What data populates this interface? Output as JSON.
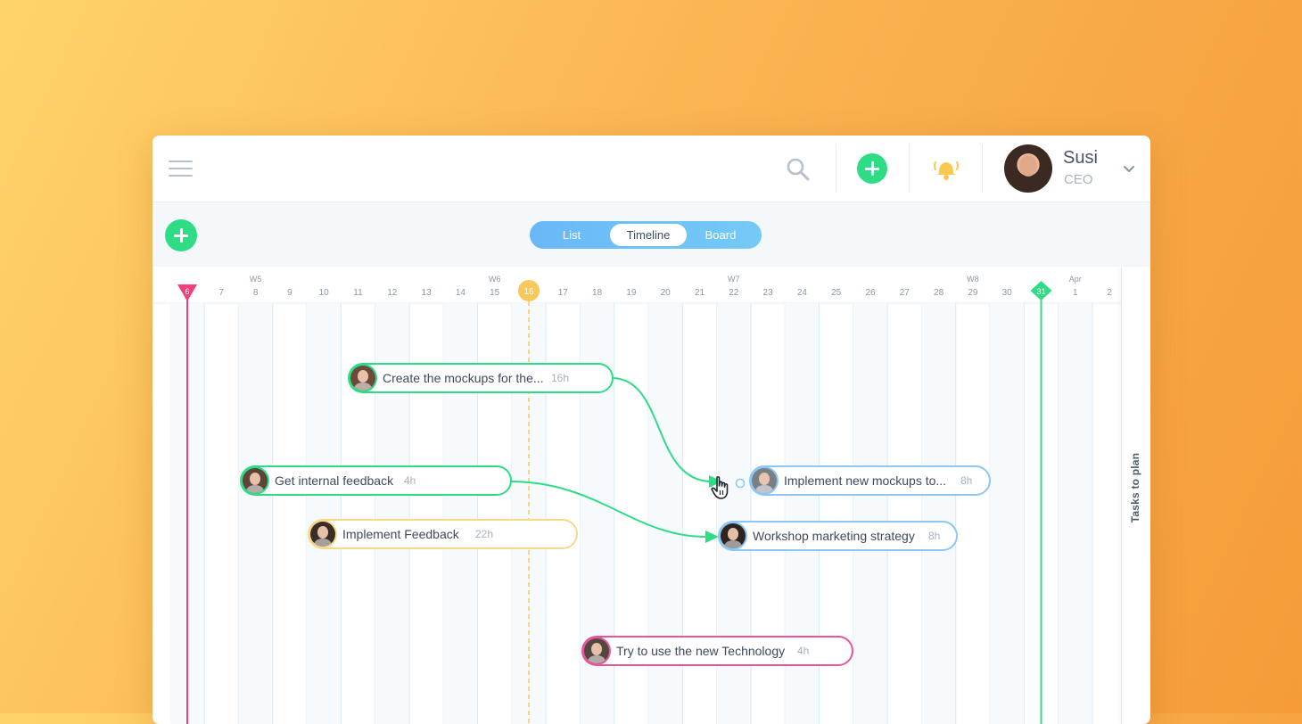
{
  "header": {
    "user_name": "Susi",
    "user_role": "CEO"
  },
  "view_switch": {
    "options": [
      "List",
      "Timeline",
      "Board"
    ],
    "active": "Timeline"
  },
  "timeline": {
    "days": [
      "6",
      "7",
      "8",
      "9",
      "10",
      "11",
      "12",
      "13",
      "14",
      "15",
      "16",
      "17",
      "18",
      "19",
      "20",
      "21",
      "22",
      "23",
      "24",
      "25",
      "26",
      "27",
      "28",
      "29",
      "30",
      "31",
      "1",
      "2"
    ],
    "weeks": [
      {
        "label": "W5",
        "day": "8"
      },
      {
        "label": "W6",
        "day": "15"
      },
      {
        "label": "W7",
        "day": "22"
      },
      {
        "label": "W8",
        "day": "29"
      },
      {
        "label": "Apr",
        "day": "1"
      }
    ],
    "today": "16",
    "start_marker": "6",
    "end_marker": "31"
  },
  "tasks": [
    {
      "title": "Create the mockups for the...",
      "hours": "16h",
      "color": "#2fdc86"
    },
    {
      "title": "Get internal feedback",
      "hours": "4h",
      "color": "#2fdc86"
    },
    {
      "title": "Implement Feedback",
      "hours": "22h",
      "color": "#f7d98a"
    },
    {
      "title": "Implement new mockups to...",
      "hours": "8h",
      "color": "#8ec7f3"
    },
    {
      "title": "Workshop marketing strategy",
      "hours": "8h",
      "color": "#8ec7f3"
    },
    {
      "title": "Try to use the new Technology",
      "hours": "4h",
      "color": "#e8569a"
    }
  ],
  "side_panel": {
    "label": "Tasks to plan"
  },
  "colors": {
    "accent_green": "#2fdc86",
    "today_marker": "#f8c85a",
    "start_marker": "#f0417f",
    "view_switch": "#6ab8f7"
  },
  "icons": [
    "hamburger-icon",
    "search-icon",
    "plus-icon",
    "bell-icon",
    "chevron-down-icon",
    "hand-cursor-icon"
  ]
}
